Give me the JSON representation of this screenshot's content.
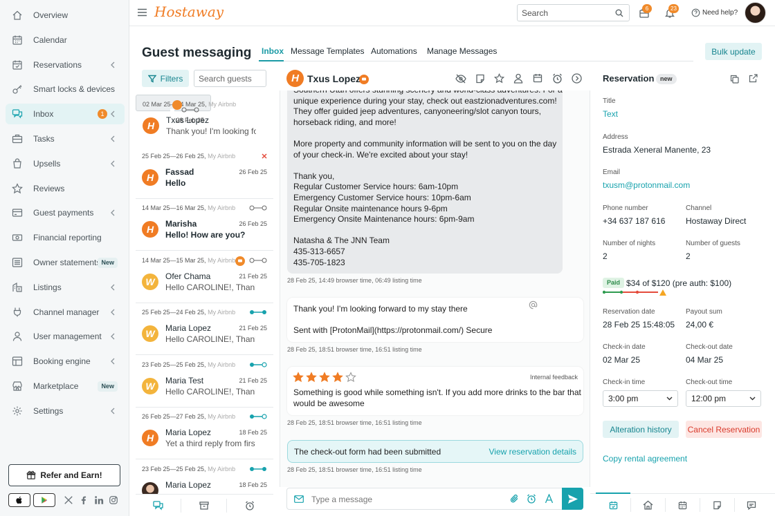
{
  "app": {
    "brand": "Hostaway",
    "brand_color": "#f07c24",
    "accent": "#17a2ad"
  },
  "sidebar": {
    "items": [
      {
        "label": "Overview",
        "icon": "home-icon"
      },
      {
        "label": "Calendar",
        "icon": "calendar-icon"
      },
      {
        "label": "Reservations",
        "icon": "calendar-check-icon",
        "chevron": true
      },
      {
        "label": "Smart locks & devices",
        "icon": "key-icon"
      },
      {
        "label": "Inbox",
        "icon": "chat-icon",
        "chevron": true,
        "badge": "1",
        "active": true
      },
      {
        "label": "Tasks",
        "icon": "briefcase-icon",
        "chevron": true
      },
      {
        "label": "Upsells",
        "icon": "bag-icon",
        "chevron": true
      },
      {
        "label": "Reviews",
        "icon": "star-icon"
      },
      {
        "label": "Guest payments",
        "icon": "card-icon",
        "chevron": true
      },
      {
        "label": "Financial reporting",
        "icon": "cash-icon"
      },
      {
        "label": "Owner statements",
        "icon": "list-icon",
        "tag": "New"
      },
      {
        "label": "Listings",
        "icon": "building-icon",
        "chevron": true
      },
      {
        "label": "Channel manager",
        "icon": "plug-icon",
        "chevron": true
      },
      {
        "label": "User management",
        "icon": "user-icon",
        "chevron": true
      },
      {
        "label": "Booking engine",
        "icon": "layout-icon",
        "chevron": true
      },
      {
        "label": "Marketplace",
        "icon": "store-icon",
        "tag": "New"
      },
      {
        "label": "Settings",
        "icon": "gear-icon",
        "chevron": true
      }
    ],
    "refer_label": "Refer and Earn!"
  },
  "header": {
    "search_placeholder": "Search",
    "tasks_badge": "6",
    "notifications_badge": "23",
    "help_label": "Need help?"
  },
  "page": {
    "title": "Guest messaging",
    "tabs": [
      "Inbox",
      "Message Templates",
      "Automations",
      "Manage Messages"
    ],
    "bulk_update": "Bulk update"
  },
  "list": {
    "filters_label": "Filters",
    "search_placeholder": "Search guests",
    "conversations": [
      {
        "dates": "02 Mar 25—04 Mar 25,",
        "source": "My Airbnb",
        "name": "Txus Lopez",
        "date": "28 Feb 25",
        "preview": "Thank you! I'm looking forward",
        "avatar": "H",
        "status": "pending",
        "chat": true,
        "selected": true
      },
      {
        "dates": "25 Feb 25—26 Feb 25,",
        "source": "My Airbnb",
        "name": "Fassad",
        "date": "26 Feb 25",
        "preview": "Hello",
        "avatar": "H",
        "status": "cancelled",
        "unread": true
      },
      {
        "dates": "14 Mar 25—16 Mar 25,",
        "source": "My Airbnb",
        "name": "Marisha",
        "date": "26 Feb 25",
        "preview": "Hello! How are you?",
        "avatar": "H",
        "status": "pending",
        "unread": true
      },
      {
        "dates": "14 Mar 25—15 Mar 25,",
        "source": "My Airbnb",
        "name": "Ofer Chama",
        "date": "21 Feb 25",
        "preview": "Hello CAROLINE!, Thank you",
        "avatar": "W",
        "status": "pending",
        "chat": true
      },
      {
        "dates": "25 Feb 25—24 Feb 25,",
        "source": "My Airbnb",
        "name": "Maria Lopez",
        "date": "21 Feb 25",
        "preview": "Hello CAROLINE!, Thank you",
        "avatar": "W",
        "status": "done"
      },
      {
        "dates": "23 Feb 25—25 Feb 25,",
        "source": "My Airbnb",
        "name": "Maria Test",
        "date": "21 Feb 25",
        "preview": "Hello CAROLINE!, Thank you",
        "avatar": "W",
        "status": "active"
      },
      {
        "dates": "26 Feb 25—27 Feb 25,",
        "source": "My Airbnb",
        "name": "Maria Lopez",
        "date": "18 Feb 25",
        "preview": "Yet a third reply from first",
        "avatar": "H",
        "status": "active"
      },
      {
        "dates": "23 Feb 25—25 Feb 25,",
        "source": "My Airbnb",
        "name": "Maria Lopez",
        "date": "18 Feb 25",
        "preview": "",
        "avatar": "photo",
        "status": "done"
      }
    ]
  },
  "chat": {
    "guest_name": "Txus Lopez",
    "msg1_lines": [
      "Southern Utah offers stunning scenery and world-class adventures. For a",
      "unique experience during your stay, check out eastzionadventures.com!",
      "They offer guided jeep adventures, canyoneering/slot canyon tours,",
      "horseback riding, and more!",
      "",
      "More property and community information will be sent to you on the day",
      "of your check-in. We're excited about your stay!",
      "",
      "Thank you,",
      "Regular Customer Service hours: 6am-10pm",
      "Emergency Customer Service hours: 10pm-6am",
      "Regular Onsite maintenance hours 9-6pm",
      "Emergency Onsite Maintenance hours: 6pm-9am",
      "",
      "Natasha & The JNN Team",
      "435-313-6657",
      "435-705-1823"
    ],
    "msg1_meta": "28 Feb 25, 14:49 browser time, 06:49 listing time",
    "msg2_line1": "Thank you! I'm looking forward to my stay there",
    "msg2_line2": "Sent with [ProtonMail](https://protonmail.com/) Secure",
    "msg2_meta": "28 Feb 25, 18:51 browser time, 16:51 listing time",
    "feedback_label": "Internal feedback",
    "feedback_rating": 4,
    "feedback_line1": "Something is good while something isn't. If you add more drinks to the bar that",
    "feedback_line2": "would be awesome",
    "feedback_meta": "28 Feb 25, 18:51 browser time, 16:51 listing time",
    "notice_text": "The check-out form had been submitted",
    "notice_link": "View reservation details",
    "notice_meta": "28 Feb 25, 18:51 browser time, 16:51 listing time",
    "composer_placeholder": "Type a message"
  },
  "reservation": {
    "heading": "Reservation",
    "tag": "new",
    "title_label": "Title",
    "title_value": "Text",
    "address_label": "Address",
    "address_value": "Estrada Xeneral Manente, 23",
    "email_label": "Email",
    "email_value": "txusm@protonmail.com",
    "phone_label": "Phone number",
    "phone_value": "+34 637 187 616",
    "channel_label": "Channel",
    "channel_value": "Hostaway Direct",
    "nights_label": "Number of nights",
    "nights_value": "2",
    "guests_label": "Number of guests",
    "guests_value": "2",
    "paid_tag": "Paid",
    "paid_text": "$34 of $120 (pre auth: $100)",
    "res_date_label": "Reservation date",
    "res_date_value": "28 Feb 25 15:48:05",
    "payout_label": "Payout sum",
    "payout_value": "24,00 €",
    "checkin_date_label": "Check-in date",
    "checkin_date_value": "02 Mar 25",
    "checkout_date_label": "Check-out date",
    "checkout_date_value": "04 Mar 25",
    "checkin_time_label": "Check-in time",
    "checkin_time_value": "3:00 pm",
    "checkout_time_label": "Check-out time",
    "checkout_time_value": "12:00 pm",
    "alteration_label": "Alteration history",
    "cancel_label": "Cancel Reservation",
    "copy_label": "Copy rental agreement"
  }
}
